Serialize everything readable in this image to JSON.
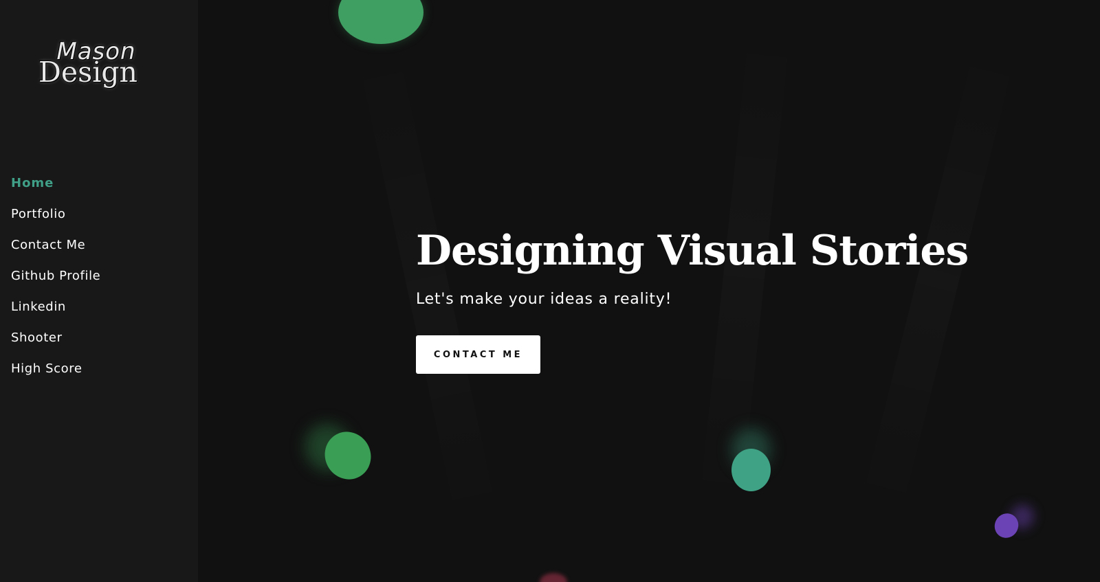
{
  "brand": {
    "logo_text_top": "Mason",
    "logo_text_bottom": "Design"
  },
  "nav": {
    "items": [
      {
        "label": "Home",
        "active": true
      },
      {
        "label": "Portfolio",
        "active": false
      },
      {
        "label": "Contact Me",
        "active": false
      },
      {
        "label": "Github Profile",
        "active": false
      },
      {
        "label": "Linkedin",
        "active": false
      },
      {
        "label": "Shooter",
        "active": false
      },
      {
        "label": "High Score",
        "active": false
      }
    ]
  },
  "hero": {
    "title": "Designing Visual Stories",
    "subtitle": "Let's make your ideas a reality!",
    "cta_label": "CONTACT ME"
  },
  "colors": {
    "background": "#111111",
    "sidebar": "#181818",
    "accent": "#3f9f87",
    "orb_green": "#3f9e62",
    "orb_teal": "#3fa285",
    "orb_purple": "#6c43b5",
    "orb_red": "#7a2a3b"
  }
}
